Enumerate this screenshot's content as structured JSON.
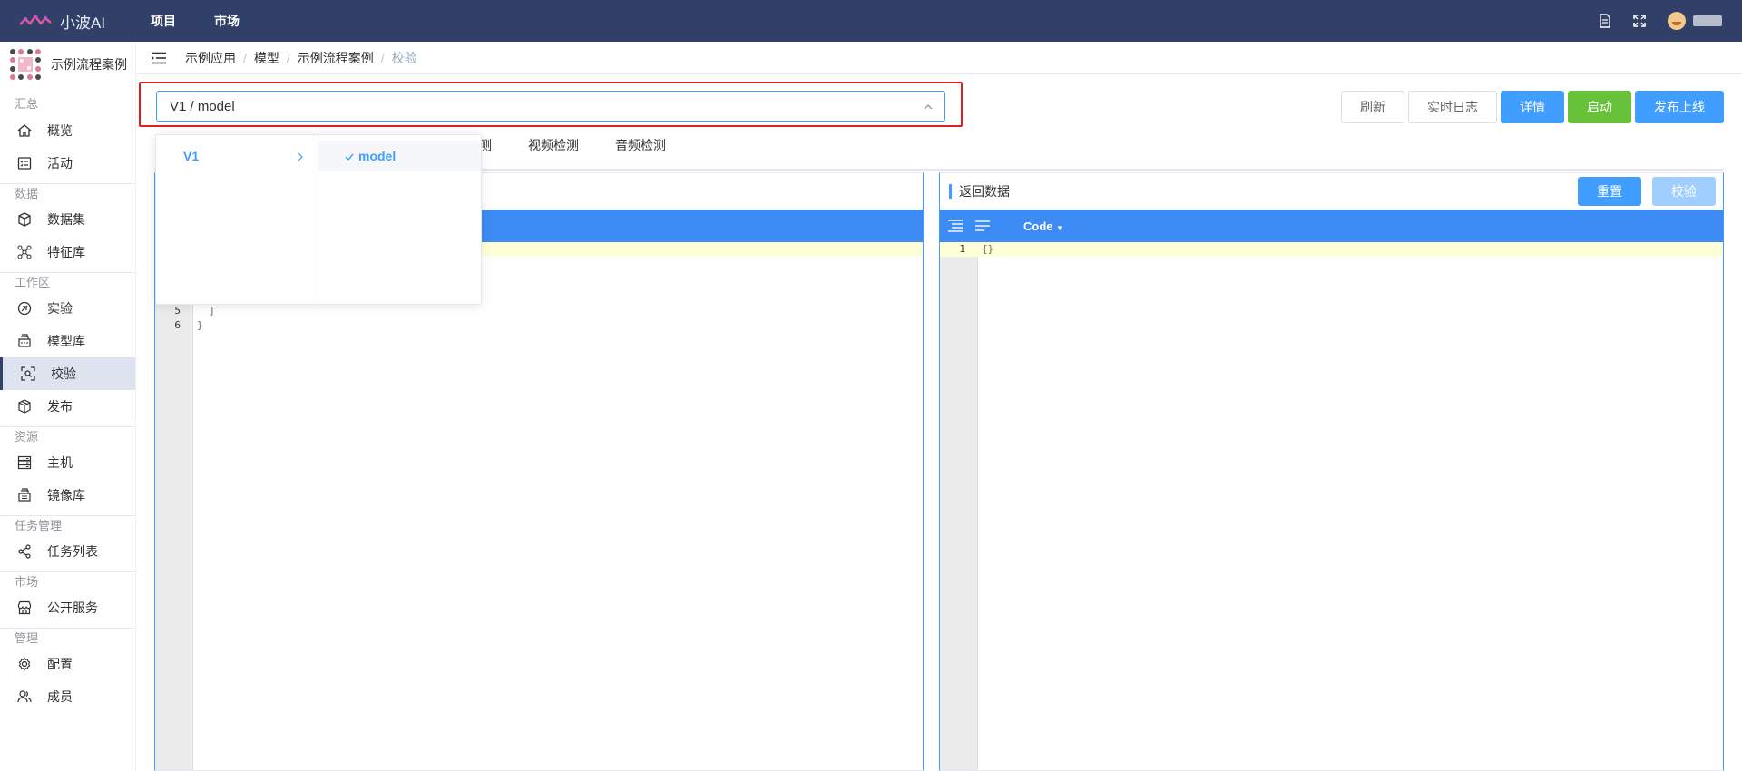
{
  "app": {
    "name": "小波AI"
  },
  "topnav": [
    {
      "label": "项目"
    },
    {
      "label": "市场"
    }
  ],
  "project": {
    "name": "示例流程案例"
  },
  "sidebar": {
    "groups": [
      {
        "label": "汇总",
        "items": [
          {
            "label": "概览",
            "icon": "home-icon"
          },
          {
            "label": "活动",
            "icon": "activity-icon"
          }
        ]
      },
      {
        "label": "数据",
        "items": [
          {
            "label": "数据集",
            "icon": "dataset-cube-icon"
          },
          {
            "label": "特征库",
            "icon": "feature-graph-icon"
          }
        ]
      },
      {
        "label": "工作区",
        "items": [
          {
            "label": "实验",
            "icon": "experiment-icon"
          },
          {
            "label": "模型库",
            "icon": "model-library-icon"
          },
          {
            "label": "校验",
            "icon": "verify-scan-icon",
            "active": true
          },
          {
            "label": "发布",
            "icon": "publish-box-icon"
          }
        ]
      },
      {
        "label": "资源",
        "items": [
          {
            "label": "主机",
            "icon": "server-icon"
          },
          {
            "label": "镜像库",
            "icon": "image-repo-icon"
          }
        ]
      },
      {
        "label": "任务管理",
        "items": [
          {
            "label": "任务列表",
            "icon": "task-share-icon"
          }
        ]
      },
      {
        "label": "市场",
        "items": [
          {
            "label": "公开服务",
            "icon": "store-icon"
          }
        ]
      },
      {
        "label": "管理",
        "items": [
          {
            "label": "配置",
            "icon": "settings-gear-icon"
          },
          {
            "label": "成员",
            "icon": "members-icon"
          }
        ]
      }
    ]
  },
  "breadcrumb": [
    "示例应用",
    "模型",
    "示例流程案例",
    "校验"
  ],
  "selector": {
    "value": "V1 / model"
  },
  "cascader": {
    "level1": [
      {
        "label": "V1"
      }
    ],
    "level2": [
      {
        "label": "model",
        "selected": true
      }
    ]
  },
  "actions": {
    "refresh": "刷新",
    "realtime_log": "实时日志",
    "details": "详情",
    "start": "启动",
    "publish_online": "发布上线"
  },
  "tabs": [
    "测",
    "视频检测",
    "音频检测"
  ],
  "left_editor": {
    "lines": [
      {
        "n": "5",
        "text": "  ]"
      },
      {
        "n": "6",
        "text": "}"
      }
    ]
  },
  "right_panel": {
    "title": "返回数据",
    "reset": "重置",
    "verify": "校验",
    "mode": "Code",
    "lines": [
      {
        "n": "1",
        "text": "{}"
      }
    ]
  },
  "colors": {
    "topbar": "#304068",
    "primary": "#409eff",
    "success": "#67c23a",
    "highlight_border": "#e41d1d",
    "editor_toolbar": "#3d8bf4"
  }
}
